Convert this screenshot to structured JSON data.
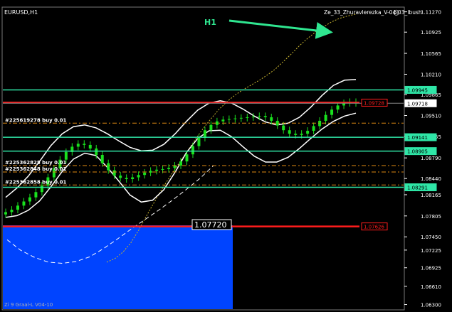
{
  "window": {
    "symbol_timeframe": "EURUSD,H1",
    "indicator_name": "Ze_33_Zhuravlerezka_V-04-03_Ibush",
    "face_glyph": "☺",
    "footer_label": "Zi 9 Graal-L V04-10",
    "annotation": "H1"
  },
  "colors": {
    "background": "#000000",
    "candles": "#19e01e",
    "envelope": "#ffffff",
    "cyan_levels": "#2fe6a7",
    "red_levels": "#ff1c1c",
    "orange_dash": "#e08a12",
    "yellow_dot": "#c9b531",
    "blue_box": "#0044ff",
    "axis_text": "#ffffff",
    "arrow": "#2fe690"
  },
  "price_axis": {
    "min": 1.0621,
    "max": 1.1135,
    "ticks": [
      "1.11270",
      "1.10925",
      "1.10565",
      "1.10210",
      "1.09865",
      "1.09510",
      "1.09155",
      "1.08790",
      "1.08440",
      "1.08165",
      "1.07805",
      "1.07450",
      "1.07225",
      "1.06925",
      "1.06610",
      "1.06300"
    ],
    "tick_values": [
      1.1127,
      1.10925,
      1.10565,
      1.1021,
      1.09865,
      1.0951,
      1.09155,
      1.0879,
      1.0844,
      1.08165,
      1.07805,
      1.0745,
      1.07225,
      1.06925,
      1.0661,
      1.063
    ]
  },
  "levels": [
    {
      "price": 1.09945,
      "label": "1.09945",
      "kind": "cyan"
    },
    {
      "price": 1.09728,
      "label": "1.09728",
      "kind": "red"
    },
    {
      "price": 1.09718,
      "label": "1.09718",
      "kind": "current"
    },
    {
      "price": 1.09141,
      "label": "1.09141",
      "kind": "cyan"
    },
    {
      "price": 1.08905,
      "label": "1.08905",
      "kind": "cyan"
    },
    {
      "price": 1.08291,
      "label": "1.08291",
      "kind": "cyan"
    },
    {
      "price": 1.07626,
      "label": "1.07626",
      "kind": "red"
    }
  ],
  "price_readout": "1.07720",
  "orders": [
    {
      "label": "#225619278 buy 0.01",
      "price": 1.0938
    },
    {
      "label": "#225362825 buy 0.01",
      "price": 1.0866
    },
    {
      "label": "#225362848 buy 0.01",
      "price": 1.0855
    },
    {
      "label": "#225362858 buy 0.01",
      "price": 1.0833
    }
  ],
  "orange_levels": [
    1.0938,
    1.0866,
    1.0855,
    1.0833
  ],
  "chart_data": {
    "type": "line",
    "candles_close": [
      1.0787,
      1.0791,
      1.0798,
      1.0805,
      1.0812,
      1.0821,
      1.0832,
      1.0846,
      1.0861,
      1.0876,
      1.0889,
      1.0898,
      1.0903,
      1.0901,
      1.0895,
      1.0884,
      1.087,
      1.0858,
      1.0849,
      1.0845,
      1.0843,
      1.0846,
      1.085,
      1.0854,
      1.0857,
      1.0859,
      1.086,
      1.0862,
      1.0866,
      1.0873,
      1.0885,
      1.0899,
      1.0913,
      1.0926,
      1.0935,
      1.0941,
      1.0944,
      1.0945,
      1.0946,
      1.0947,
      1.0948,
      1.0949,
      1.095,
      1.0948,
      1.0942,
      1.0934,
      1.0926,
      1.092,
      1.0918,
      1.092,
      1.0925,
      1.0933,
      1.0942,
      1.0952,
      1.0961,
      1.0968,
      1.0972,
      1.0974,
      1.0972
    ],
    "envelope_upper": [
      1.0812,
      1.0828,
      1.0848,
      1.0873,
      1.09,
      1.092,
      1.0932,
      1.0935,
      1.093,
      1.092,
      1.0908,
      1.0897,
      1.0891,
      1.0892,
      1.0902,
      1.092,
      1.0941,
      1.096,
      1.0972,
      1.0976,
      1.0972,
      1.0962,
      1.095,
      1.094,
      1.0935,
      1.0938,
      1.0948,
      1.0965,
      1.0985,
      1.1002,
      1.1011,
      1.1012
    ],
    "envelope_lower": [
      1.0778,
      1.0781,
      1.079,
      1.0806,
      1.083,
      1.0856,
      1.0877,
      1.0887,
      1.0883,
      1.0863,
      1.084,
      1.0816,
      1.0804,
      1.0807,
      1.0825,
      1.0855,
      1.0888,
      1.0912,
      1.0925,
      1.0926,
      1.0915,
      1.0898,
      1.0882,
      1.0872,
      1.0872,
      1.088,
      1.0895,
      1.0912,
      1.0928,
      1.0941,
      1.095,
      1.0955
    ],
    "yellow_dotted": [
      1.0702,
      1.0708,
      1.0719,
      1.0735,
      1.0757,
      1.0782,
      1.0806,
      1.0829,
      1.085,
      1.087,
      1.089,
      1.091,
      1.0929,
      1.0946,
      1.0962,
      1.0975,
      1.0986,
      1.0995,
      1.1003,
      1.1011,
      1.102,
      1.103,
      1.1043,
      1.1056,
      1.107,
      1.1082,
      1.1093,
      1.1102,
      1.111,
      1.1116,
      1.112,
      1.1123
    ],
    "white_dash": [
      1.074,
      1.0722,
      1.071,
      1.0702,
      1.07,
      1.0703,
      1.0711,
      1.0725,
      1.0741,
      1.0758,
      1.0774,
      1.079,
      1.0807,
      1.0825,
      1.0844,
      1.0866
    ]
  }
}
